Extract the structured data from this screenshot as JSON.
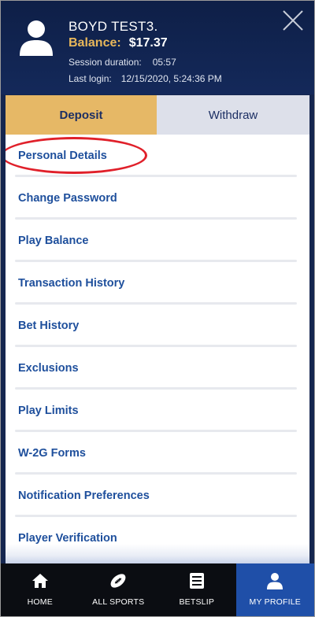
{
  "header": {
    "user_name": "BOYD TEST3.",
    "balance_label": "Balance:",
    "balance_value": "$17.37",
    "session_label": "Session duration:",
    "session_value": "05:57",
    "last_login_label": "Last login:",
    "last_login_value": "12/15/2020, 5:24:36 PM"
  },
  "tabs": [
    {
      "label": "Deposit",
      "active": true
    },
    {
      "label": "Withdraw",
      "active": false
    }
  ],
  "menu": {
    "items": [
      {
        "label": "Personal Details",
        "highlighted": true
      },
      {
        "label": "Change Password"
      },
      {
        "label": "Play Balance"
      },
      {
        "label": "Transaction History"
      },
      {
        "label": "Bet History"
      },
      {
        "label": "Exclusions"
      },
      {
        "label": "Play Limits"
      },
      {
        "label": "W-2G Forms"
      },
      {
        "label": "Notification Preferences"
      },
      {
        "label": "Player Verification"
      }
    ]
  },
  "bottom_nav": {
    "items": [
      {
        "label": "HOME",
        "icon": "home-icon"
      },
      {
        "label": "ALL SPORTS",
        "icon": "football-icon"
      },
      {
        "label": "BETSLIP",
        "icon": "betslip-icon"
      },
      {
        "label": "MY PROFILE",
        "icon": "profile-icon",
        "active": true
      }
    ]
  },
  "colors": {
    "header_bg": "#0e1f47",
    "gold": "#e6b866",
    "link_blue": "#1e4f9c",
    "active_nav": "#1f4fa8",
    "highlight_red": "#e0202a"
  }
}
